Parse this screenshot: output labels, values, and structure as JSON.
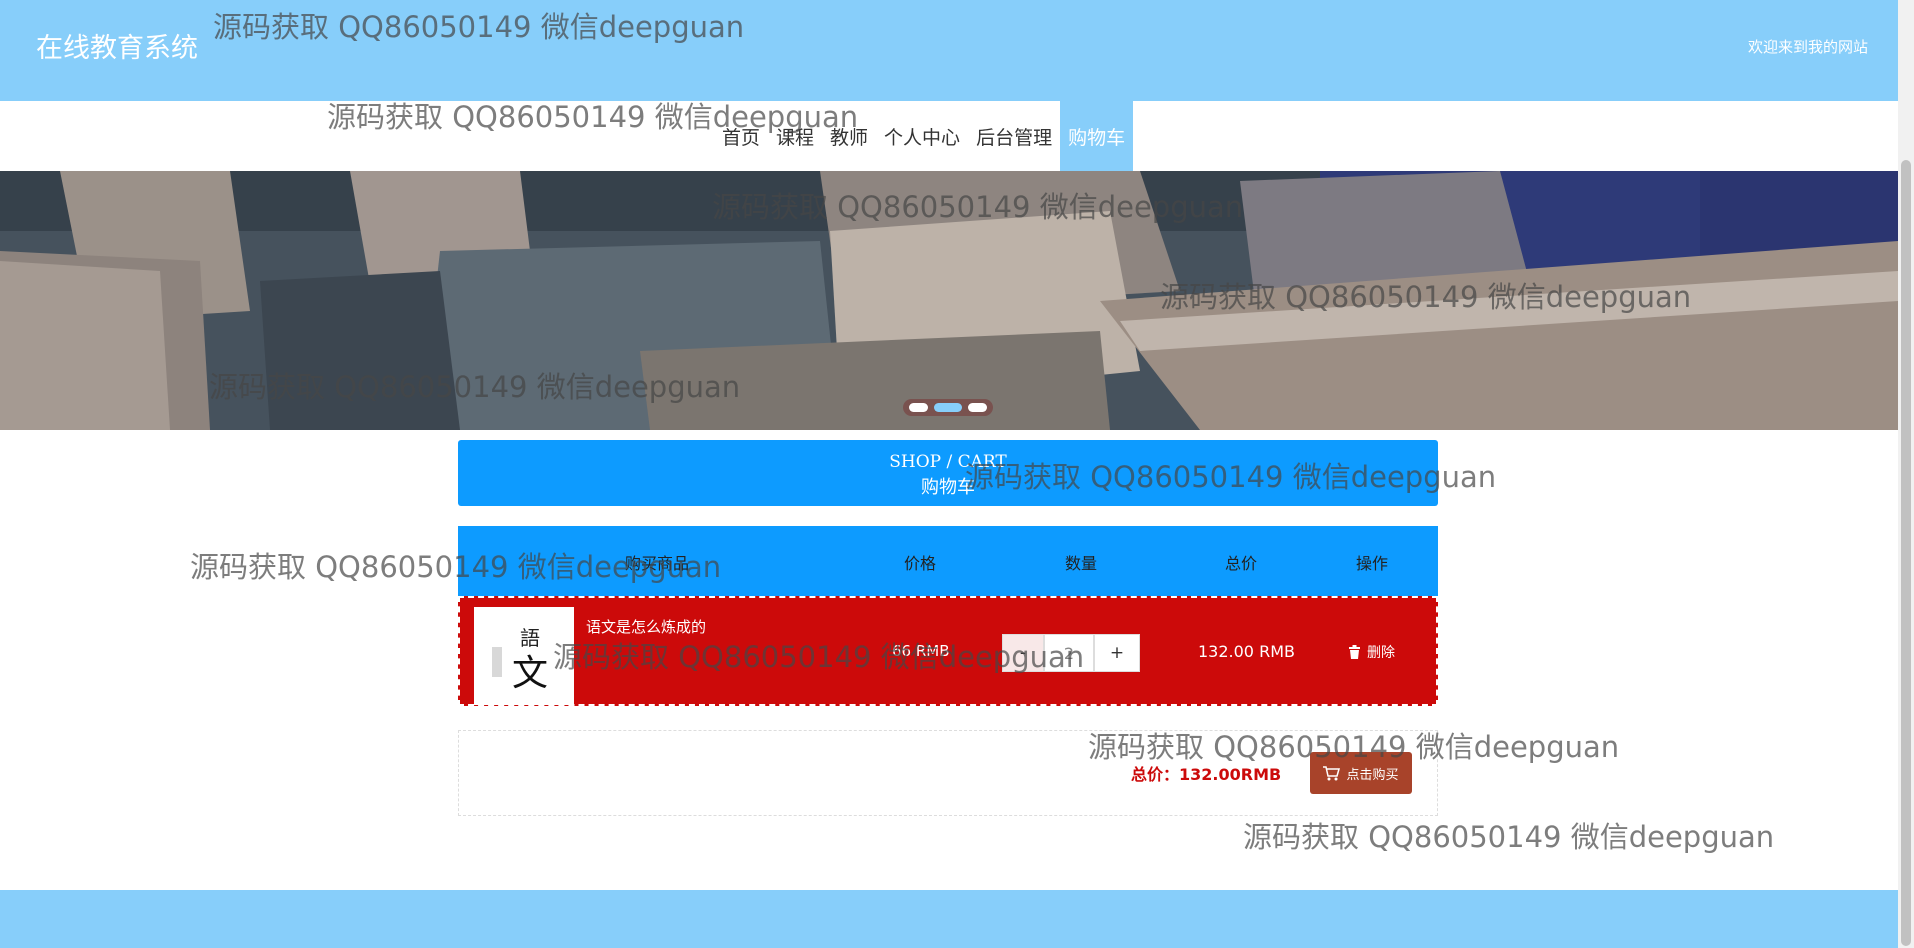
{
  "header": {
    "title": "在线教育系统",
    "welcome": "欢迎来到我的网站"
  },
  "nav": {
    "items": [
      "首页",
      "课程",
      "教师",
      "个人中心",
      "后台管理",
      "购物车"
    ],
    "active_index": 5
  },
  "carousel": {
    "slides": 3,
    "active_index": 1
  },
  "cart": {
    "title_en": "SHOP / CART",
    "title_zh": "购物车",
    "columns": [
      "购买商品",
      "价格",
      "数量",
      "总价",
      "操作"
    ],
    "items": [
      {
        "name": "语文是怎么炼成的",
        "price": "66 RMB",
        "quantity": "2",
        "total": "132.00 RMB",
        "delete_label": "删除",
        "thumb_text": "语文"
      }
    ],
    "stepper": {
      "minus": "-",
      "plus": "+"
    },
    "grand_total": "总价：132.00RMB",
    "buy_label": "点击购买"
  },
  "watermark": "源码获取 QQ86050149 微信deepguan",
  "colors": {
    "header": "#87cefa",
    "cart_blue": "#0d9bff",
    "row_red": "#cc0a0a",
    "buy_button": "#a8432a"
  }
}
